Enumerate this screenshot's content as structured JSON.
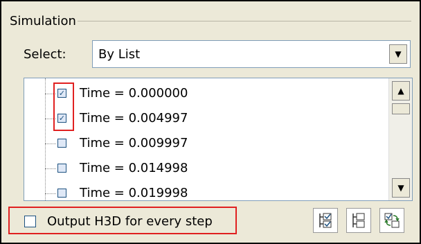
{
  "group": {
    "title": "Simulation"
  },
  "select": {
    "label": "Select:",
    "value": "By List"
  },
  "list": {
    "items": [
      {
        "label": "Time = 0.000000",
        "checked": true
      },
      {
        "label": "Time = 0.004997",
        "checked": true
      },
      {
        "label": "Time = 0.009997",
        "checked": false
      },
      {
        "label": "Time = 0.014998",
        "checked": false
      },
      {
        "label": "Time = 0.019998",
        "checked": false
      }
    ]
  },
  "options": {
    "output_h3d_label": "Output H3D for every step",
    "output_h3d_checked": false
  },
  "toolbar": {
    "buttons": [
      {
        "icon": "select-all-icon"
      },
      {
        "icon": "deselect-all-icon"
      },
      {
        "icon": "swap-selection-icon"
      }
    ]
  },
  "colors": {
    "highlight": "#e02020",
    "panel": "#ece9d8",
    "border": "#7f9db9"
  }
}
